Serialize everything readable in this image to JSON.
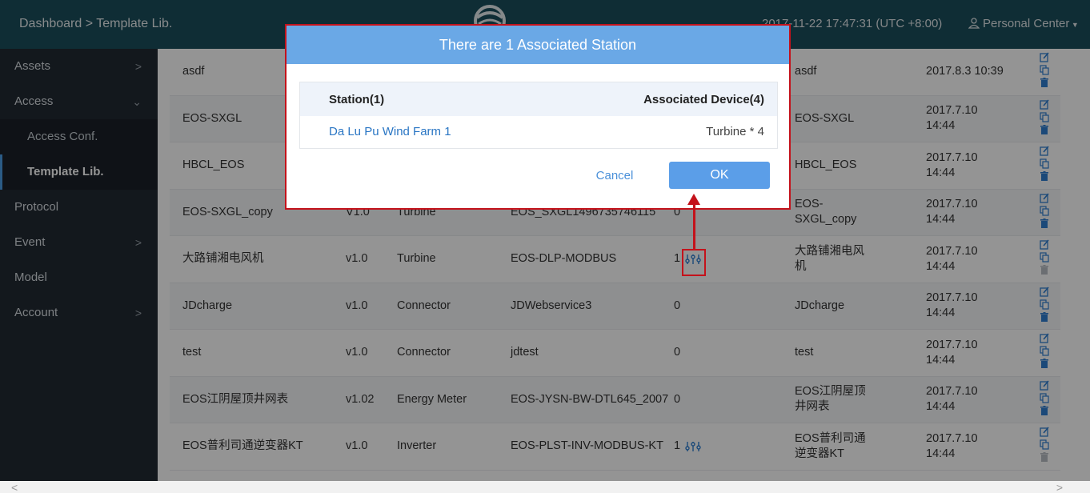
{
  "header": {
    "breadcrumb": "Dashboard > Template Lib.",
    "datetime": "2017-11-22 17:47:31 (UTC +8:00)",
    "personal": "Personal Center"
  },
  "sidebar": {
    "items": [
      {
        "label": "Assets",
        "chevron": ">"
      },
      {
        "label": "Access",
        "chevron": "v"
      },
      {
        "label": "Access Conf."
      },
      {
        "label": "Template Lib."
      },
      {
        "label": "Protocol"
      },
      {
        "label": "Event",
        "chevron": ">"
      },
      {
        "label": "Model"
      },
      {
        "label": "Account",
        "chevron": ">"
      }
    ]
  },
  "table": {
    "rows": [
      {
        "name": "asdf",
        "version": "",
        "type": "",
        "protocol": "",
        "count": "",
        "alias": "asdf",
        "time": "2017.8.3 10:39",
        "delete_enabled": true
      },
      {
        "name": "EOS-SXGL",
        "version": "",
        "type": "",
        "protocol": "",
        "count": "",
        "alias": "EOS-SXGL",
        "time": "2017.7.10 14:44",
        "delete_enabled": true
      },
      {
        "name": "HBCL_EOS",
        "version": "",
        "type": "",
        "protocol": "",
        "count": "",
        "alias": "HBCL_EOS",
        "time": "2017.7.10 14:44",
        "delete_enabled": true
      },
      {
        "name": "EOS-SXGL_copy",
        "version": "V1.0",
        "type": "Turbine",
        "protocol": "EOS_SXGL1496735746115",
        "count": "0",
        "alias": "EOS-SXGL_copy",
        "time": "2017.7.10 14:44",
        "delete_enabled": true
      },
      {
        "name": "大路铺湘电风机",
        "version": "v1.0",
        "type": "Turbine",
        "protocol": "EOS-DLP-MODBUS",
        "count": "1",
        "alias": "大路铺湘电风机",
        "time": "2017.7.10 14:44",
        "delete_enabled": false,
        "assoc_icon": true
      },
      {
        "name": "JDcharge",
        "version": "v1.0",
        "type": "Connector",
        "protocol": "JDWebservice3",
        "count": "0",
        "alias": "JDcharge",
        "time": "2017.7.10 14:44",
        "delete_enabled": true
      },
      {
        "name": "test",
        "version": "v1.0",
        "type": "Connector",
        "protocol": "jdtest",
        "count": "0",
        "alias": "test",
        "time": "2017.7.10 14:44",
        "delete_enabled": true
      },
      {
        "name": "EOS江阴屋顶井网表",
        "version": "v1.02",
        "type": "Energy Meter",
        "protocol": "EOS-JYSN-BW-DTL645_2007",
        "count": "0",
        "alias": "EOS江阴屋顶井网表",
        "time": "2017.7.10 14:44",
        "delete_enabled": true
      },
      {
        "name": "EOS普利司通逆变器KT",
        "version": "v1.0",
        "type": "Inverter",
        "protocol": "EOS-PLST-INV-MODBUS-KT",
        "count": "1",
        "alias": "EOS普利司通逆变器KT",
        "time": "2017.7.10 14:44",
        "delete_enabled": false,
        "assoc_icon": true
      }
    ]
  },
  "modal": {
    "title": "There are 1 Associated Station",
    "col_station": "Station(1)",
    "col_device": "Associated Device(4)",
    "station_name": "Da Lu Pu Wind Farm 1",
    "device_text": "Turbine * 4",
    "cancel_label": "Cancel",
    "ok_label": "OK"
  },
  "colors": {
    "header_bg": "#1b4e5c",
    "sidebar_bg": "#222a33",
    "modal_header": "#6aa8e6",
    "highlight_red": "#c4121b",
    "link_blue": "#2a76c4"
  }
}
